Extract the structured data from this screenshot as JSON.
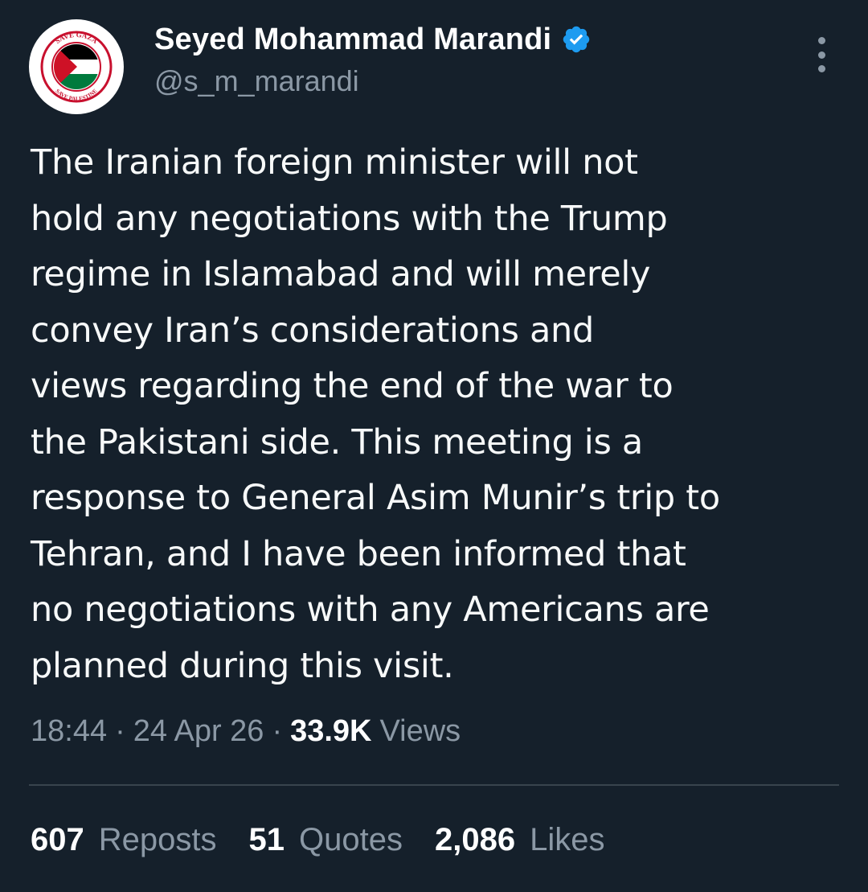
{
  "author": {
    "display_name": "Seyed Mohammad Marandi",
    "handle": "@s_m_marandi",
    "verified_icon": "verified-badge-icon",
    "avatar_text_top": "SAVE GAZA",
    "avatar_text_bottom": "SAVE PALESTINE"
  },
  "tweet": {
    "text": "The Iranian foreign minister will not\nhold any negotiations with the Trump\nregime in Islamabad and will merely\nconvey Iran’s considerations and\nviews regarding the end of the war to\nthe Pakistani side. This meeting is a\nresponse to General Asim Munir’s trip to\nTehran, and I have been informed that\nno negotiations with any Americans are\nplanned during this visit."
  },
  "meta": {
    "time": "18:44",
    "date": "24 Apr 26",
    "separator": "·",
    "views_count": "33.9K",
    "views_label": "Views"
  },
  "stats": {
    "reposts_count": "607",
    "reposts_label": "Reposts",
    "quotes_count": "51",
    "quotes_label": "Quotes",
    "likes_count": "2,086",
    "likes_label": "Likes"
  },
  "colors": {
    "background": "#15202b",
    "primary_text": "#ffffff",
    "secondary_text": "#8b98a5",
    "verified_blue": "#1d9bf0",
    "divider": "#38444d"
  }
}
